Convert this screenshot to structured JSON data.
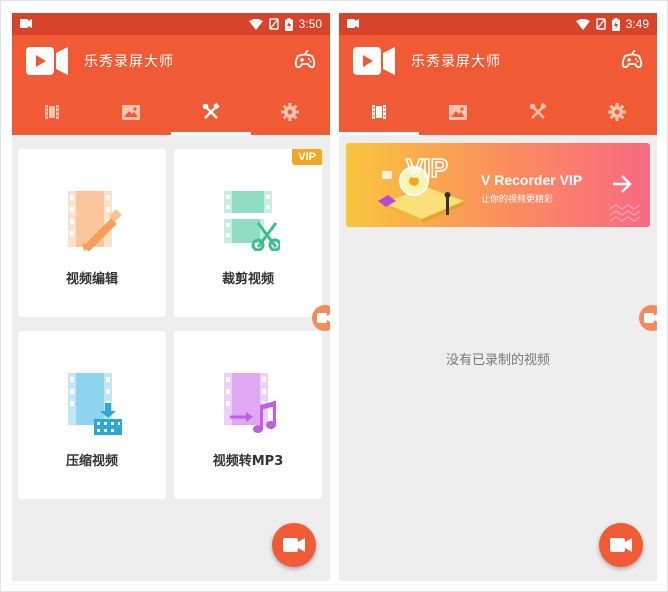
{
  "left_screen": {
    "status": {
      "time": "3:50"
    },
    "app": {
      "title": "乐秀录屏大师"
    },
    "tabs": [
      {
        "icon": "film-icon",
        "active": false
      },
      {
        "icon": "image-icon",
        "active": false
      },
      {
        "icon": "tools-icon",
        "active": true
      },
      {
        "icon": "settings-icon",
        "active": false
      }
    ],
    "tools": [
      {
        "label": "视频编辑",
        "icon": "video-edit-icon"
      },
      {
        "label": "裁剪视频",
        "icon": "video-trim-icon",
        "badge": "VIP"
      },
      {
        "label": "压缩视频",
        "icon": "video-compress-icon"
      },
      {
        "label": "视频转MP3",
        "icon": "video-to-mp3-icon"
      }
    ]
  },
  "right_screen": {
    "status": {
      "time": "3:49"
    },
    "app": {
      "title": "乐秀录屏大师"
    },
    "tabs": [
      {
        "icon": "film-icon",
        "active": true
      },
      {
        "icon": "image-icon",
        "active": false
      },
      {
        "icon": "tools-icon",
        "active": false
      },
      {
        "icon": "settings-icon",
        "active": false
      }
    ],
    "banner": {
      "badge_text": "VIP",
      "title": "V Recorder VIP",
      "subtitle": "让你的视频更精彩"
    },
    "empty_message": "没有已录制的视频"
  },
  "colors": {
    "status_bar": "#d8442a",
    "app_bar": "#f05a35",
    "background": "#eeeeee",
    "vip_badge": "#f5a623"
  }
}
